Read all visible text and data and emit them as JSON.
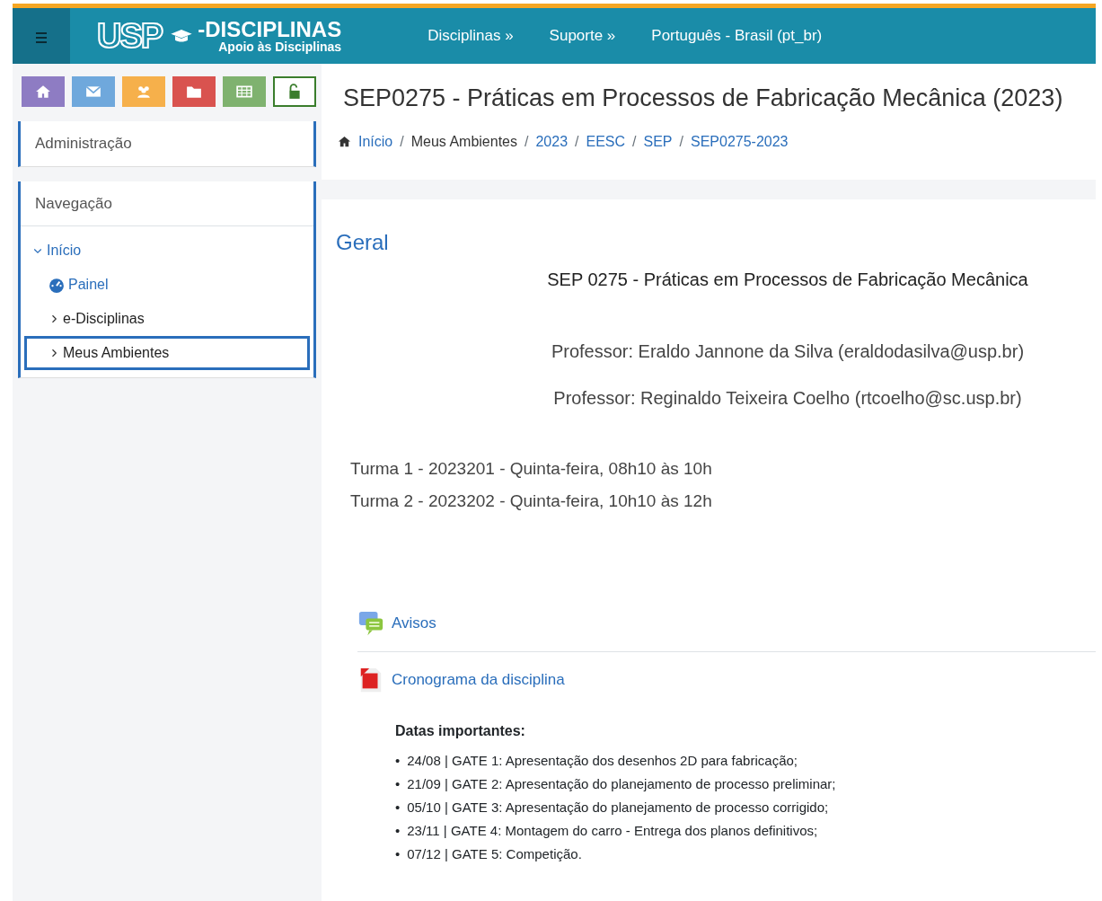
{
  "navbar": {
    "logo": {
      "mark": "USP",
      "title": "-DISCIPLINAS",
      "subtitle": "Apoio às Disciplinas"
    },
    "menu": [
      "Disciplinas »",
      "Suporte »",
      "Português - Brasil (pt_br)"
    ]
  },
  "quick_buttons": [
    {
      "kind": "home",
      "color": "#8e7cc3",
      "outline": false
    },
    {
      "kind": "mail",
      "color": "#6fa8dc",
      "outline": false
    },
    {
      "kind": "people",
      "color": "#f6b04b",
      "outline": false
    },
    {
      "kind": "folder",
      "color": "#d9534f",
      "outline": false
    },
    {
      "kind": "grid",
      "color": "#7fb26f",
      "outline": false
    },
    {
      "kind": "lock",
      "color": "#3a7d2c",
      "outline": true
    }
  ],
  "blocks": [
    {
      "title": "Administração"
    },
    {
      "title": "Navegação",
      "tree": [
        {
          "label": "Início",
          "link": true,
          "expanded": true,
          "selected": false,
          "children": [
            {
              "label": "Painel",
              "kind": "dashboard",
              "link": true,
              "selected": false
            },
            {
              "label": "e-Disciplinas",
              "kind": "branch",
              "link": false,
              "expanded": false,
              "selected": false
            },
            {
              "label": "Meus Ambientes",
              "kind": "branch",
              "link": false,
              "expanded": false,
              "selected": true
            }
          ]
        }
      ]
    }
  ],
  "page_title": "SEP0275 - Práticas em Processos de Fabricação Mecânica (2023)",
  "breadcrumb": [
    {
      "label": "Início",
      "link": true
    },
    {
      "separator": "/",
      "label": "Meus Ambientes",
      "link": false
    },
    {
      "separator": "/",
      "label": "2023",
      "link": true
    },
    {
      "separator": "/",
      "label": "EESC",
      "link": true
    },
    {
      "separator": "/",
      "label": "SEP",
      "link": true
    },
    {
      "separator": "/",
      "label": "SEP0275-2023",
      "link": true
    }
  ],
  "section": {
    "title": "Geral",
    "course_name": "SEP 0275 - Práticas em Processos de Fabricação Mecânica",
    "professors": [
      "Professor: Eraldo Jannone da Silva (eraldodasilva@usp.br)",
      "Professor: Reginaldo Teixeira Coelho (rtcoelho@sc.usp.br)"
    ],
    "classes": [
      "Turma 1 - 2023201 - Quinta-feira, 08h10 às 10h",
      "Turma 2 - 2023202 - Quinta-feira, 10h10 às 12h"
    ],
    "activities": [
      {
        "kind": "forum",
        "label": "Avisos"
      },
      {
        "kind": "pdf",
        "label": "Cronograma da disciplina"
      }
    ],
    "dates_title": "Datas importantes:",
    "dates": [
      {
        "bullet": "•",
        "text": "24/08 | GATE 1: Apresentação dos desenhos 2D para fabricação;"
      },
      {
        "bullet": "•",
        "text": "21/09 | GATE 2: Apresentação do planejamento de processo preliminar;"
      },
      {
        "bullet": "•",
        "text": "05/10 | GATE 3: Apresentação do planejamento de processo corrigido;"
      },
      {
        "bullet": "•",
        "text": "23/11 | GATE 4: Montagem do carro - Entrega dos planos definitivos;"
      },
      {
        "bullet": "•",
        "text": "07/12 | GATE 5: Competição."
      }
    ]
  }
}
